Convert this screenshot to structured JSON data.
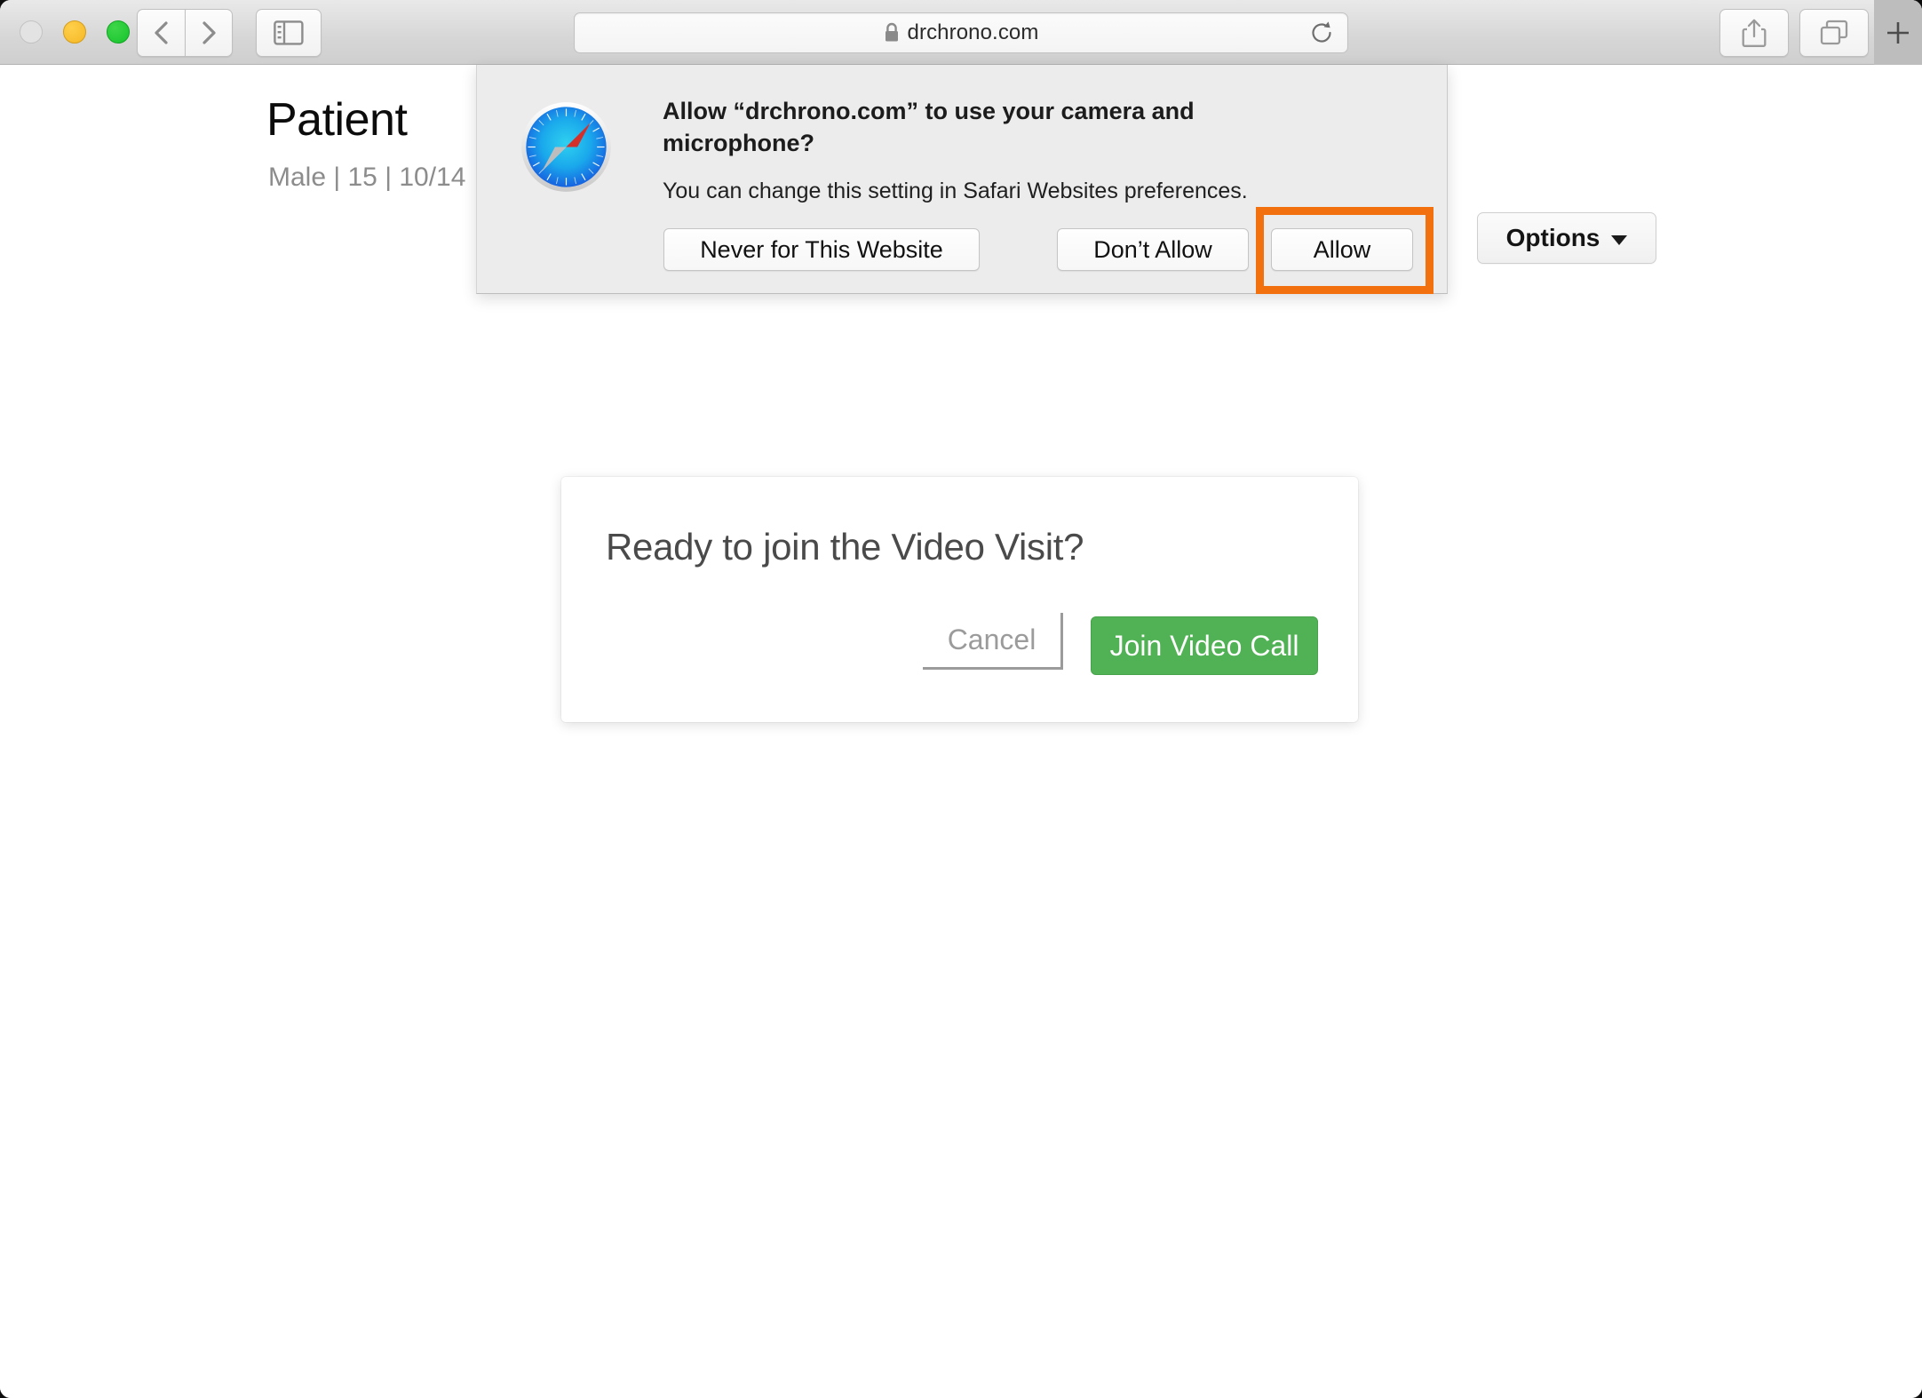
{
  "browser": {
    "name": "Safari",
    "traffic_lights": [
      "close-button",
      "minimize-button",
      "maximize-button"
    ],
    "back_icon": "chevron-left-icon",
    "forward_icon": "chevron-right-icon",
    "sidebar_icon": "sidebar-icon",
    "share_icon": "share-icon",
    "tabs_icon": "tab-overview-icon",
    "new_tab_label": "+",
    "address_bar": {
      "lock_icon": "lock-icon",
      "url": "drchrono.com",
      "reload_icon": "reload-icon"
    }
  },
  "page": {
    "patient_title": "Patient",
    "patient_subtitle": "Male | 15 | 10/14",
    "options_label": "Options",
    "options_caret_icon": "chevron-down-icon"
  },
  "join_modal": {
    "title": "Ready to join the Video Visit?",
    "cancel_label": "Cancel",
    "join_label": "Join Video Call",
    "join_color": "#51b155"
  },
  "permission_sheet": {
    "app_icon": "safari-compass-icon",
    "heading": "Allow “drchrono.com” to use your camera and microphone?",
    "subtext": "You can change this setting in Safari Websites preferences.",
    "buttons": {
      "never": "Never for This Website",
      "dont_allow": "Don’t Allow",
      "allow": "Allow"
    }
  },
  "annotation": {
    "highlight_target": "Allow",
    "highlight_color": "#f2700d"
  }
}
